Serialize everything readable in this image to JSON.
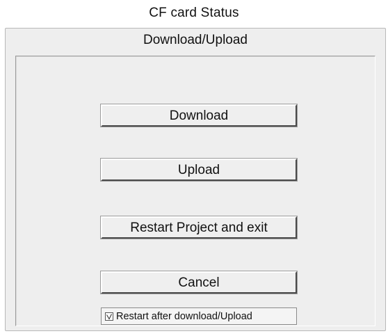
{
  "window": {
    "title": "CF card  Status"
  },
  "dialog": {
    "header": "Download/Upload",
    "buttons": {
      "download": "Download",
      "upload": "Upload",
      "restart": "Restart  Project and  exit",
      "cancel": "Cancel"
    },
    "restart_option": {
      "label": "Restart after download/Upload",
      "checked": true
    }
  },
  "colors": {
    "dialog_bg": "#eeeeee",
    "button_bg": "#efefef",
    "button_shadow": "#4a4a4a"
  }
}
